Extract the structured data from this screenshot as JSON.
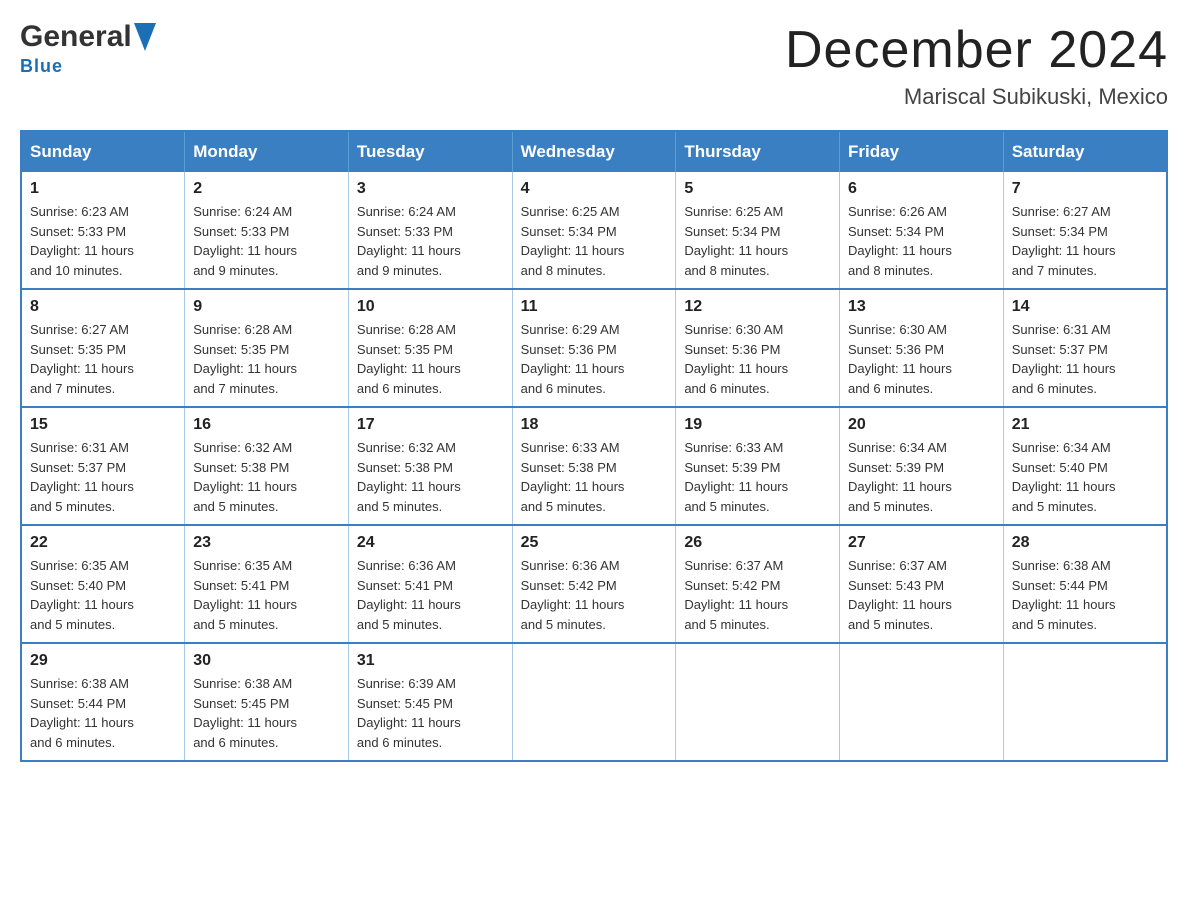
{
  "header": {
    "logo_general": "General",
    "logo_blue": "Blue",
    "month_title": "December 2024",
    "location": "Mariscal Subikuski, Mexico"
  },
  "days_of_week": [
    "Sunday",
    "Monday",
    "Tuesday",
    "Wednesday",
    "Thursday",
    "Friday",
    "Saturday"
  ],
  "weeks": [
    [
      {
        "day": "1",
        "sunrise": "6:23 AM",
        "sunset": "5:33 PM",
        "daylight": "11 hours and 10 minutes."
      },
      {
        "day": "2",
        "sunrise": "6:24 AM",
        "sunset": "5:33 PM",
        "daylight": "11 hours and 9 minutes."
      },
      {
        "day": "3",
        "sunrise": "6:24 AM",
        "sunset": "5:33 PM",
        "daylight": "11 hours and 9 minutes."
      },
      {
        "day": "4",
        "sunrise": "6:25 AM",
        "sunset": "5:34 PM",
        "daylight": "11 hours and 8 minutes."
      },
      {
        "day": "5",
        "sunrise": "6:25 AM",
        "sunset": "5:34 PM",
        "daylight": "11 hours and 8 minutes."
      },
      {
        "day": "6",
        "sunrise": "6:26 AM",
        "sunset": "5:34 PM",
        "daylight": "11 hours and 8 minutes."
      },
      {
        "day": "7",
        "sunrise": "6:27 AM",
        "sunset": "5:34 PM",
        "daylight": "11 hours and 7 minutes."
      }
    ],
    [
      {
        "day": "8",
        "sunrise": "6:27 AM",
        "sunset": "5:35 PM",
        "daylight": "11 hours and 7 minutes."
      },
      {
        "day": "9",
        "sunrise": "6:28 AM",
        "sunset": "5:35 PM",
        "daylight": "11 hours and 7 minutes."
      },
      {
        "day": "10",
        "sunrise": "6:28 AM",
        "sunset": "5:35 PM",
        "daylight": "11 hours and 6 minutes."
      },
      {
        "day": "11",
        "sunrise": "6:29 AM",
        "sunset": "5:36 PM",
        "daylight": "11 hours and 6 minutes."
      },
      {
        "day": "12",
        "sunrise": "6:30 AM",
        "sunset": "5:36 PM",
        "daylight": "11 hours and 6 minutes."
      },
      {
        "day": "13",
        "sunrise": "6:30 AM",
        "sunset": "5:36 PM",
        "daylight": "11 hours and 6 minutes."
      },
      {
        "day": "14",
        "sunrise": "6:31 AM",
        "sunset": "5:37 PM",
        "daylight": "11 hours and 6 minutes."
      }
    ],
    [
      {
        "day": "15",
        "sunrise": "6:31 AM",
        "sunset": "5:37 PM",
        "daylight": "11 hours and 5 minutes."
      },
      {
        "day": "16",
        "sunrise": "6:32 AM",
        "sunset": "5:38 PM",
        "daylight": "11 hours and 5 minutes."
      },
      {
        "day": "17",
        "sunrise": "6:32 AM",
        "sunset": "5:38 PM",
        "daylight": "11 hours and 5 minutes."
      },
      {
        "day": "18",
        "sunrise": "6:33 AM",
        "sunset": "5:38 PM",
        "daylight": "11 hours and 5 minutes."
      },
      {
        "day": "19",
        "sunrise": "6:33 AM",
        "sunset": "5:39 PM",
        "daylight": "11 hours and 5 minutes."
      },
      {
        "day": "20",
        "sunrise": "6:34 AM",
        "sunset": "5:39 PM",
        "daylight": "11 hours and 5 minutes."
      },
      {
        "day": "21",
        "sunrise": "6:34 AM",
        "sunset": "5:40 PM",
        "daylight": "11 hours and 5 minutes."
      }
    ],
    [
      {
        "day": "22",
        "sunrise": "6:35 AM",
        "sunset": "5:40 PM",
        "daylight": "11 hours and 5 minutes."
      },
      {
        "day": "23",
        "sunrise": "6:35 AM",
        "sunset": "5:41 PM",
        "daylight": "11 hours and 5 minutes."
      },
      {
        "day": "24",
        "sunrise": "6:36 AM",
        "sunset": "5:41 PM",
        "daylight": "11 hours and 5 minutes."
      },
      {
        "day": "25",
        "sunrise": "6:36 AM",
        "sunset": "5:42 PM",
        "daylight": "11 hours and 5 minutes."
      },
      {
        "day": "26",
        "sunrise": "6:37 AM",
        "sunset": "5:42 PM",
        "daylight": "11 hours and 5 minutes."
      },
      {
        "day": "27",
        "sunrise": "6:37 AM",
        "sunset": "5:43 PM",
        "daylight": "11 hours and 5 minutes."
      },
      {
        "day": "28",
        "sunrise": "6:38 AM",
        "sunset": "5:44 PM",
        "daylight": "11 hours and 5 minutes."
      }
    ],
    [
      {
        "day": "29",
        "sunrise": "6:38 AM",
        "sunset": "5:44 PM",
        "daylight": "11 hours and 6 minutes."
      },
      {
        "day": "30",
        "sunrise": "6:38 AM",
        "sunset": "5:45 PM",
        "daylight": "11 hours and 6 minutes."
      },
      {
        "day": "31",
        "sunrise": "6:39 AM",
        "sunset": "5:45 PM",
        "daylight": "11 hours and 6 minutes."
      },
      null,
      null,
      null,
      null
    ]
  ],
  "labels": {
    "sunrise": "Sunrise:",
    "sunset": "Sunset:",
    "daylight": "Daylight:"
  }
}
